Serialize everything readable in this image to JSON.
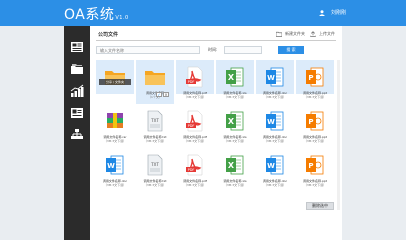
{
  "header": {
    "logo": "OA系统",
    "version": "V1.0",
    "user_name": "刘刚刚"
  },
  "main": {
    "title": "公司文件",
    "new_folder_label": "新建文件夹",
    "upload_label": "上传文件",
    "search_placeholder": "输入文件名称",
    "time_label": "时间:",
    "search_button": "搜 索",
    "delete_button": "删除选中"
  },
  "tooltip": "分享 / 文件夹",
  "files": [
    {
      "type": "folder",
      "name": "",
      "size": ""
    },
    {
      "type": "folder",
      "name": "调用文件名称",
      "size": "（1个文）"
    },
    {
      "type": "pdf",
      "name": "调用文件名称.pdf",
      "size": "（3M·3文下载）"
    },
    {
      "type": "excel",
      "name": "调用文件名称.xls",
      "size": "（3M·3文下载）"
    },
    {
      "type": "word",
      "name": "调用文件名称.doc",
      "size": "（3M·3文下载）"
    },
    {
      "type": "ppt",
      "name": "调用文件名称.ppt",
      "size": "（3M·3文下载）"
    },
    {
      "type": "rar",
      "name": "调用文件名称.rar",
      "size": "（3M·3文下载）"
    },
    {
      "type": "txt",
      "name": "调用文件名称.txt",
      "size": "（3M·3文下载）"
    },
    {
      "type": "pdf",
      "name": "调用文件名称.pdf",
      "size": "（3M·3文下载）"
    },
    {
      "type": "excel",
      "name": "调用文件名称.xls",
      "size": "（3M·3文下载）"
    },
    {
      "type": "word",
      "name": "调用文件名称.doc",
      "size": "（3M·3文下载）"
    },
    {
      "type": "ppt",
      "name": "调用文件名称.ppt",
      "size": "（3M·3文下载）"
    },
    {
      "type": "word",
      "name": "调用文件名称.doc",
      "size": "（3M·3文下载）"
    },
    {
      "type": "txt",
      "name": "调用文件名称.txt",
      "size": "（3M·3文下载）"
    },
    {
      "type": "pdf",
      "name": "调用文件名称.pdf",
      "size": "（3M·3文下载）"
    },
    {
      "type": "excel",
      "name": "调用文件名称.xls",
      "size": "（3M·3文下载）"
    },
    {
      "type": "word",
      "name": "调用文件名称.doc",
      "size": "（3M·3文下载）"
    },
    {
      "type": "ppt",
      "name": "调用文件名称.ppt",
      "size": "（3M·3文下载）"
    }
  ],
  "sidebar": {
    "items": [
      {
        "icon": "dashboard-icon"
      },
      {
        "icon": "folders-icon"
      },
      {
        "icon": "stats-icon"
      },
      {
        "icon": "news-icon"
      },
      {
        "icon": "org-chart-icon"
      }
    ]
  },
  "colors": {
    "header": "#2c8fe6",
    "sidebar": "#2b2b2b",
    "folder": "#f5a623",
    "pdf": "#e53935",
    "excel": "#43a047",
    "word": "#1e88e5",
    "ppt": "#f57c00",
    "highlight": "#dcebfa"
  }
}
